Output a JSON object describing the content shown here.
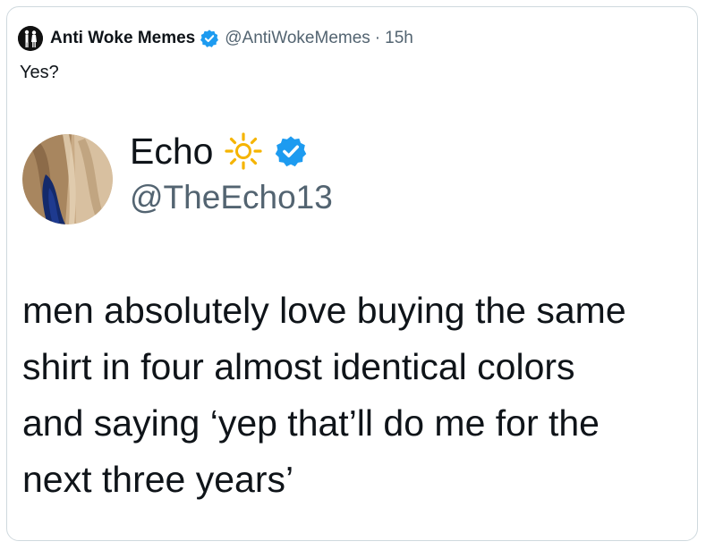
{
  "outer_tweet": {
    "author_name": "Anti Woke Memes",
    "handle": "@AntiWokeMemes",
    "separator": "·",
    "time": "15h",
    "text": "Yes?"
  },
  "inner_tweet": {
    "author_name": "Echo",
    "handle": "@TheEcho13",
    "text_lines": [
      "men absolutely love buying the same",
      "shirt in four almost identical colors",
      "and saying ‘yep that’ll do me for the",
      "next three years’"
    ]
  },
  "icons": {
    "outer_avatar": "silhouette-figures-icon",
    "verified": "verified-badge-icon",
    "sun": "sun-icon"
  },
  "colors": {
    "verified_blue": "#1d9bf0",
    "secondary_text": "#536471",
    "primary_text": "#0f1419",
    "border": "#cfd9de",
    "sun": "#f5b400"
  }
}
